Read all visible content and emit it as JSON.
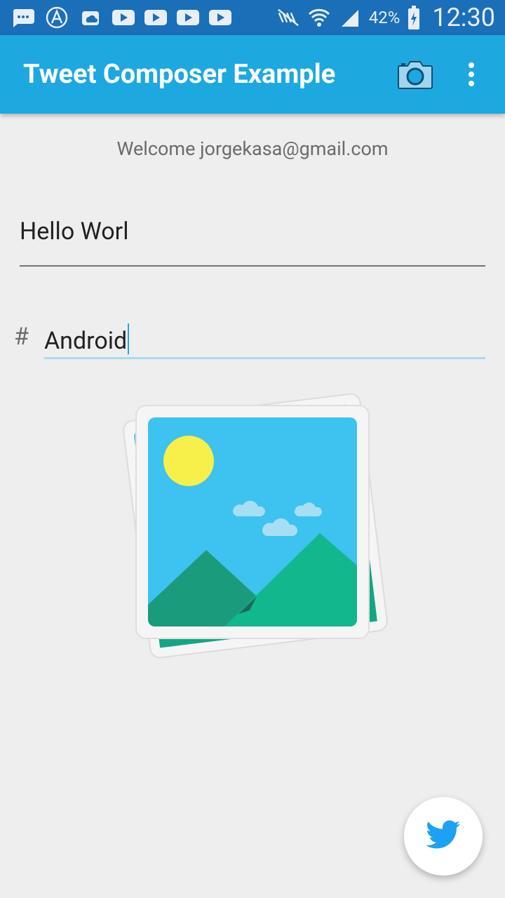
{
  "status_bar": {
    "battery": "42%",
    "time": "12:30",
    "icons": [
      "chat-icon",
      "browser-icon",
      "cloud-icon",
      "youtube-icon",
      "youtube-icon",
      "youtube-icon",
      "youtube-icon",
      "mute-icon",
      "wifi-icon",
      "signal-icon",
      "battery-icon"
    ]
  },
  "app_bar": {
    "title": "Tweet Composer Example",
    "actions": [
      "camera-icon",
      "overflow-menu-icon"
    ]
  },
  "welcome_text": "Welcome jorgekasa@gmail.com",
  "tweet_field": {
    "value": "Hello Worl"
  },
  "hashtag_field": {
    "prefix": "#",
    "value": "Android"
  },
  "image_placeholder": "gallery-placeholder-icon",
  "fab": {
    "icon": "twitter-bird-icon"
  },
  "colors": {
    "status_bar": "#1b6fb9",
    "app_bar": "#1da8e0",
    "background": "#eeeeee",
    "hashtag_underline": "#a6dcef"
  }
}
